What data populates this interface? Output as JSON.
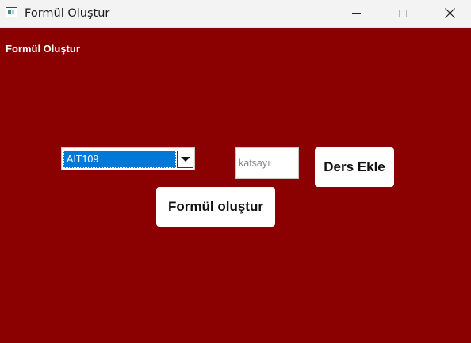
{
  "window": {
    "title": "Formül Oluştur"
  },
  "page": {
    "heading": "Formül Oluştur"
  },
  "course_select": {
    "selected": "AIT109"
  },
  "coefficient": {
    "value": "",
    "placeholder": "katsayı"
  },
  "buttons": {
    "add_course": "Ders Ekle",
    "create_formula": "Formül oluştur"
  },
  "colors": {
    "background": "#8b0000",
    "selection": "#0078d7",
    "button": "#ffffff"
  }
}
